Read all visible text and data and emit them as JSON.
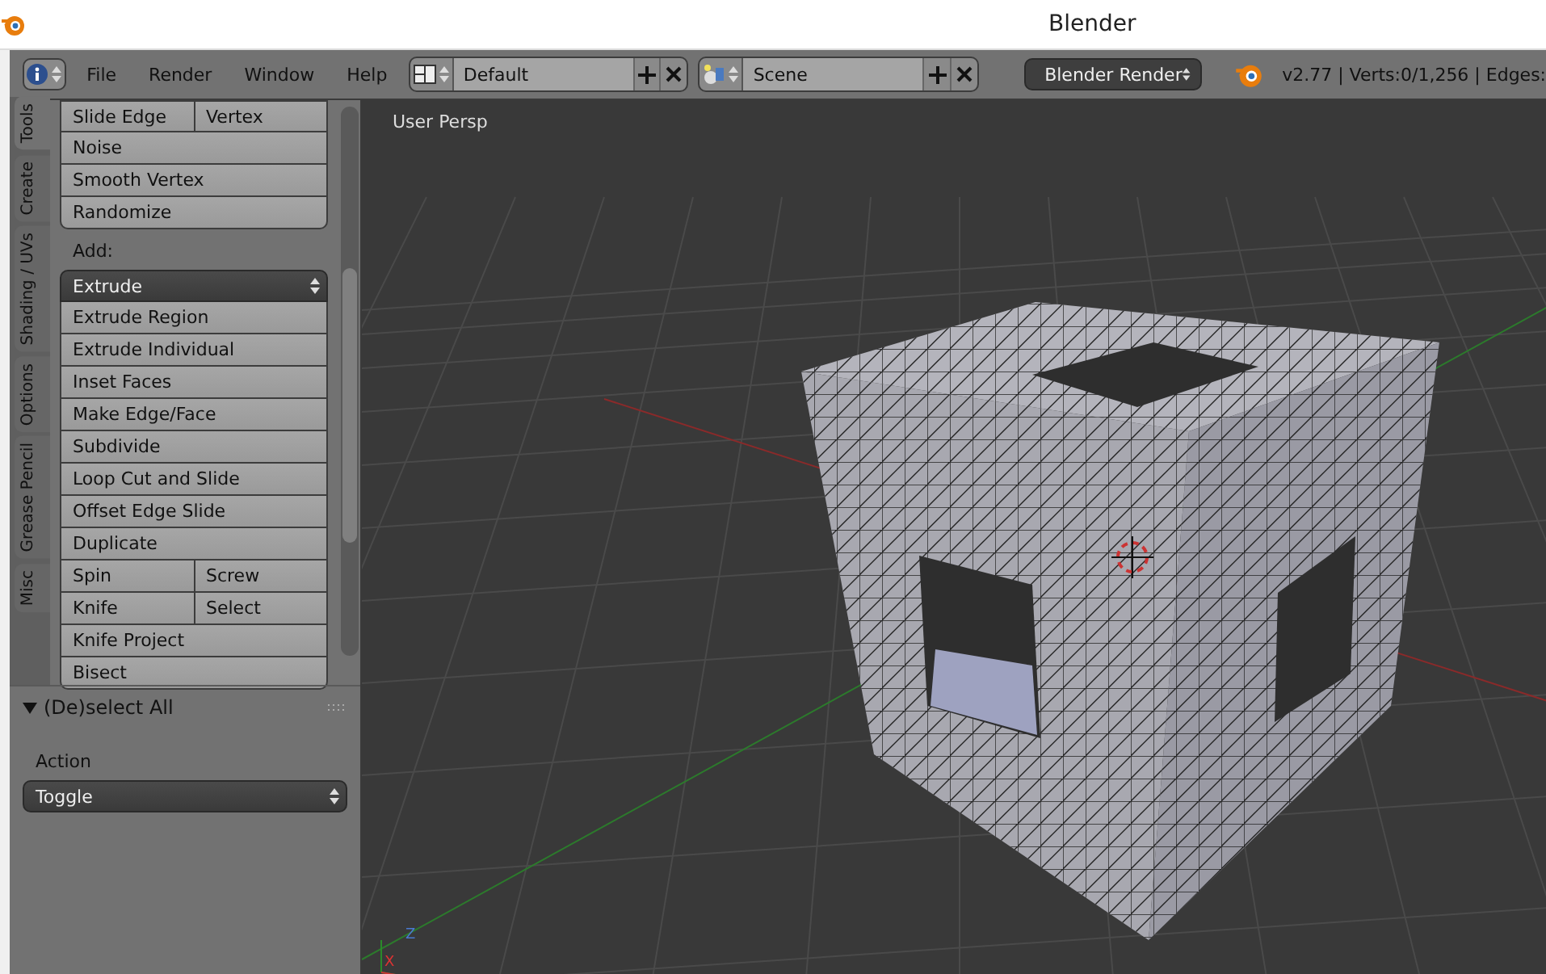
{
  "window": {
    "title": "Blender"
  },
  "header": {
    "menus": [
      "File",
      "Render",
      "Window",
      "Help"
    ],
    "layout": "Default",
    "scene": "Scene",
    "engine": "Blender Render",
    "stats": "v2.77 | Verts:0/1,256 | Edges:"
  },
  "tool_tabs": [
    {
      "label": "Tools",
      "selected": true
    },
    {
      "label": "Create",
      "selected": false
    },
    {
      "label": "Shading / UVs",
      "selected": false
    },
    {
      "label": "Options",
      "selected": false
    },
    {
      "label": "Grease Pencil",
      "selected": false
    },
    {
      "label": "Misc",
      "selected": false
    }
  ],
  "tool_groups": [
    {
      "rows": [
        [
          "Slide Edge",
          "Vertex"
        ],
        [
          "Noise"
        ],
        [
          "Smooth Vertex"
        ],
        [
          "Randomize"
        ]
      ]
    },
    {
      "title": "Add:",
      "dropdown": "Extrude",
      "rows": [
        [
          "Extrude Region"
        ],
        [
          "Extrude Individual"
        ],
        [
          "Inset Faces"
        ],
        [
          "Make Edge/Face"
        ],
        [
          "Subdivide"
        ],
        [
          "Loop Cut and Slide"
        ],
        [
          "Offset Edge Slide"
        ],
        [
          "Duplicate"
        ],
        [
          "Spin",
          "Screw"
        ],
        [
          "Knife",
          "Select"
        ],
        [
          "Knife Project"
        ],
        [
          "Bisect"
        ]
      ]
    }
  ],
  "operator_panel": {
    "title": "(De)select All",
    "expanded": true,
    "field_label": "Action",
    "value": "Toggle"
  },
  "viewport": {
    "label": "User Persp",
    "gizmo_labels": [
      "Z",
      "X"
    ]
  }
}
